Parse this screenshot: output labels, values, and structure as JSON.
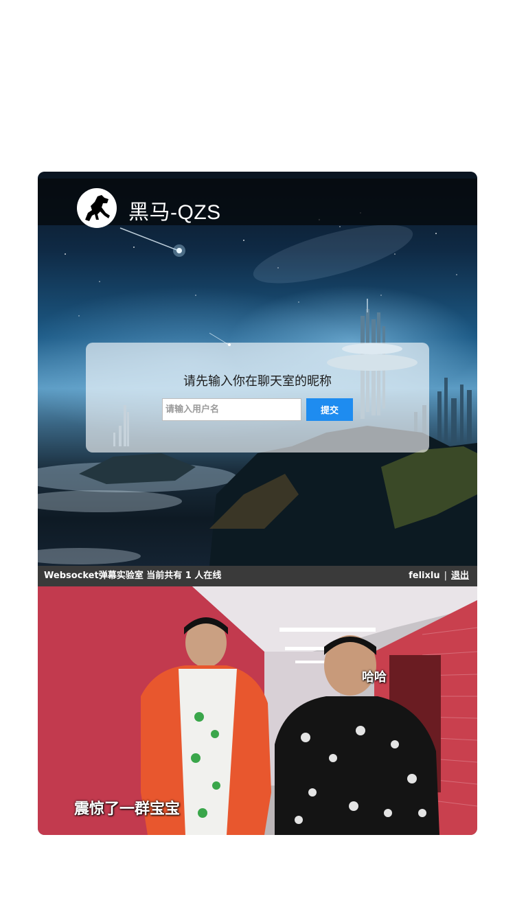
{
  "header": {
    "brand": "黑马-QZS",
    "logo_icon": "horse-logo-icon"
  },
  "login": {
    "prompt": "请先输入你在聊天室的昵称",
    "username_placeholder": "请输入用户名",
    "username_value": "",
    "submit_label": "提交",
    "submit_color": "#1e8cf0"
  },
  "status_bar": {
    "room_info": "Websocket弹幕实验室 当前共有 1 人在线",
    "username": "felixlu",
    "separator": "|",
    "logout_label": "退出"
  },
  "video": {
    "danmaku": [
      "哈哈",
      "震惊了一群宝宝"
    ]
  }
}
